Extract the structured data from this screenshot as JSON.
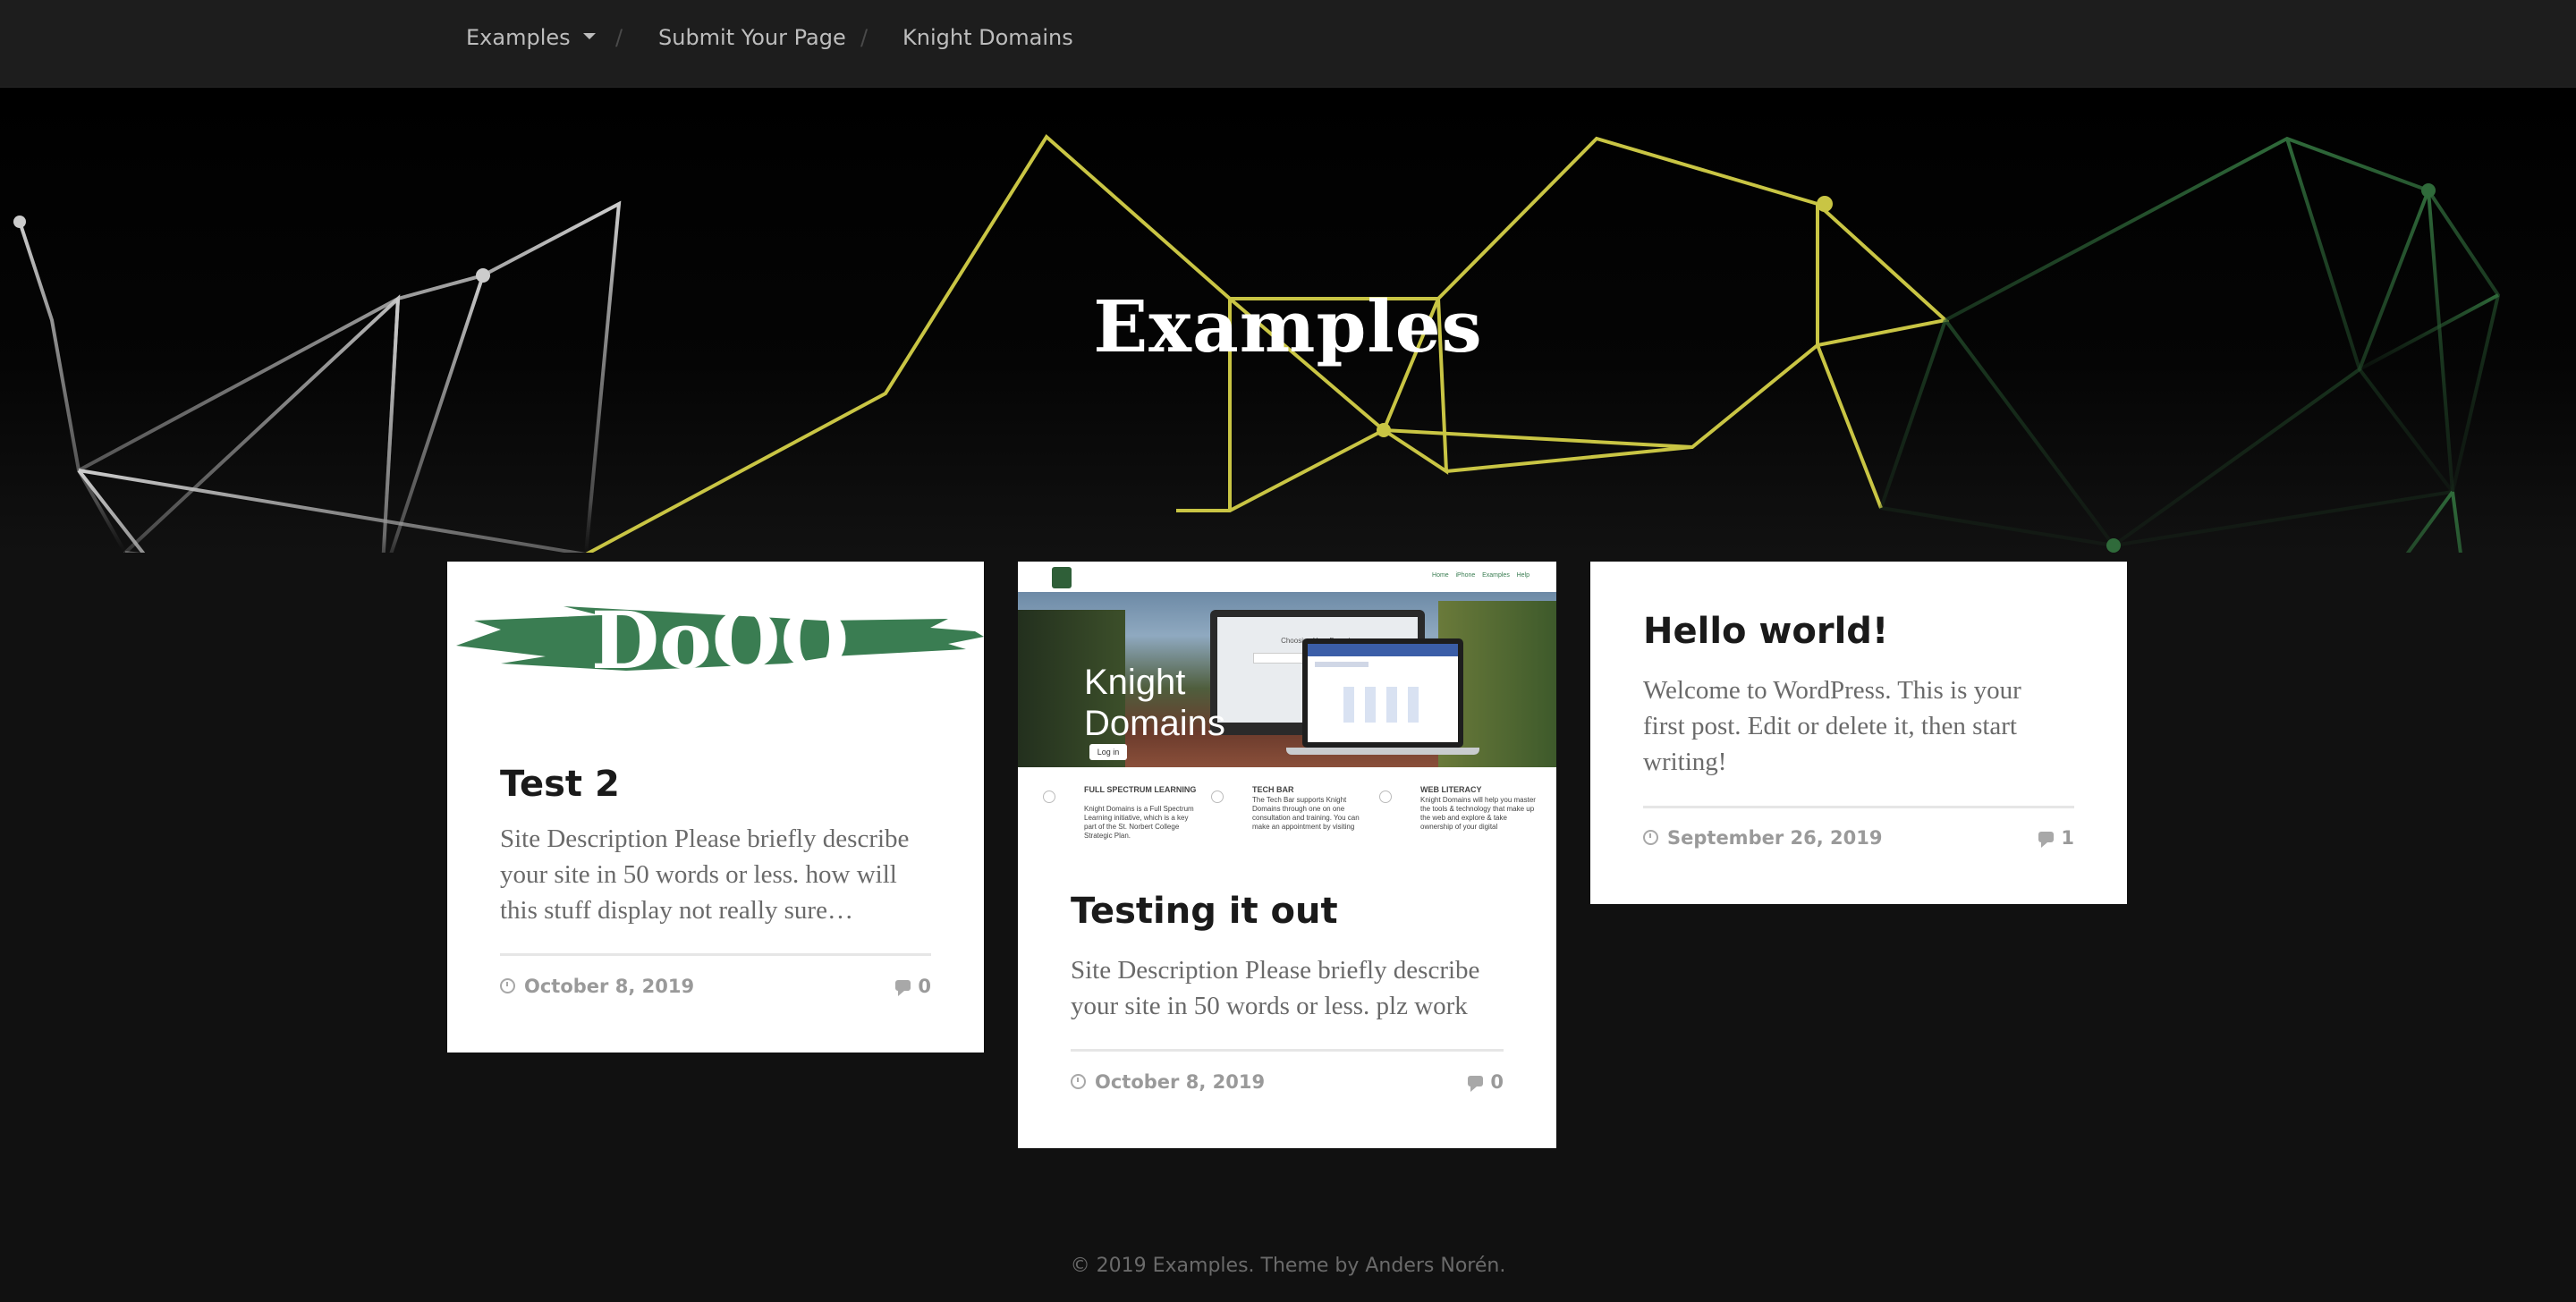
{
  "nav": {
    "items": [
      {
        "label": "Examples"
      },
      {
        "label": "Submit Your Page"
      },
      {
        "label": "Knight Domains"
      }
    ],
    "separator": "/"
  },
  "page": {
    "title": "Examples"
  },
  "posts": [
    {
      "title": "Test 2",
      "image_text": "DoOO",
      "excerpt": "Site Description Please briefly describe your site in 50 words or less. how will this stuff display not really sure…",
      "date": "October 8, 2019",
      "comments": "0"
    },
    {
      "title": "Testing it out",
      "image": {
        "nav_links": [
          "Home",
          "iPhone",
          "Examples",
          "Help"
        ],
        "heading_line1": "Knight",
        "heading_line2": "Domains",
        "login": "Log in",
        "screen_caption": "Choosing Your Domain",
        "columns": [
          {
            "title": "FULL SPECTRUM LEARNING",
            "text": "Knight Domains is a Full Spectrum Learning initiative, which is a key part of the St. Norbert College Strategic Plan."
          },
          {
            "title": "TECH BAR",
            "text": "The Tech Bar supports Knight Domains through one on one consultation and training. You can make an appointment by visiting"
          },
          {
            "title": "WEB LITERACY",
            "text": "Knight Domains will help you master the tools & technology that make up the web and explore & take ownership of your digital"
          }
        ]
      },
      "excerpt": "Site Description Please briefly describe your site in 50 words or less. plz work",
      "date": "October 8, 2019",
      "comments": "0"
    },
    {
      "title": "Hello world!",
      "excerpt": "Welcome to WordPress. This is your first post. Edit or delete it, then start writing!",
      "date": "September 26, 2019",
      "comments": "1"
    }
  ],
  "footer": {
    "text": "© 2019 Examples. Theme by Anders Norén."
  },
  "colors": {
    "nav_bg": "#1d1d1d",
    "page_bg": "#111111",
    "brush_green": "#3a7d52",
    "net_yellow": "#c9c544",
    "net_green": "#2f5f38",
    "net_gray": "#bbbbbb"
  }
}
